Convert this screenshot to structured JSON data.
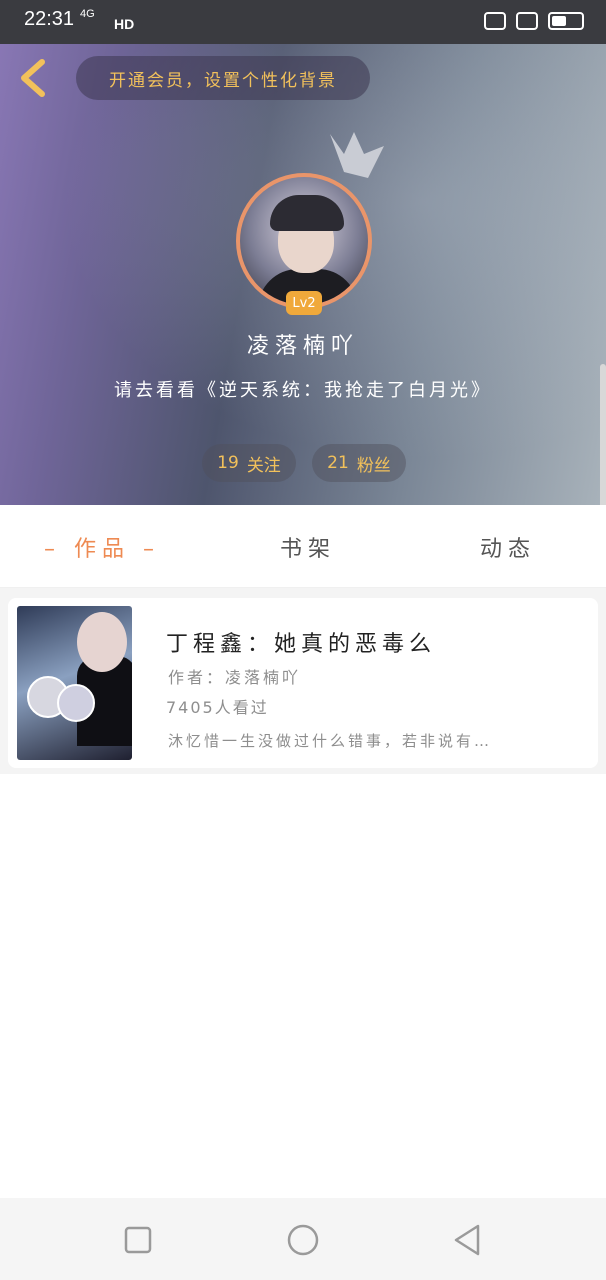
{
  "status_bar": {
    "time": "22:31",
    "network": "4G",
    "hd": "HD"
  },
  "header": {
    "tip": "开通会员，设置个性化背景",
    "nickname": "凌落楠吖",
    "level": "Lv2",
    "signature": "请去看看《逆天系统：我抢走了白月光》",
    "following_count": "19",
    "following_label": "关注",
    "fans_count": "21",
    "fans_label": "粉丝"
  },
  "tabs": [
    {
      "label": "作品",
      "active": true
    },
    {
      "label": "书架",
      "active": false
    },
    {
      "label": "动态",
      "active": false
    }
  ],
  "tab_decoration": {
    "left": "–",
    "right": "–"
  },
  "book": {
    "title": "丁程鑫：她真的恶毒么",
    "author_prefix": "作者：",
    "author": "凌落楠吖",
    "views": "7405人看过",
    "description": "沐忆惜一生没做过什么错事，若非说有…"
  },
  "colors": {
    "accent": "#ee8a52",
    "gold": "#f2c15b",
    "avatar_border": "#e9956a",
    "level_badge": "#f0a93b"
  },
  "icons": {
    "back": "chevron-left-icon",
    "crown": "crown-icon",
    "nav_recents": "square-icon",
    "nav_home": "circle-icon",
    "nav_back": "triangle-back-icon"
  }
}
